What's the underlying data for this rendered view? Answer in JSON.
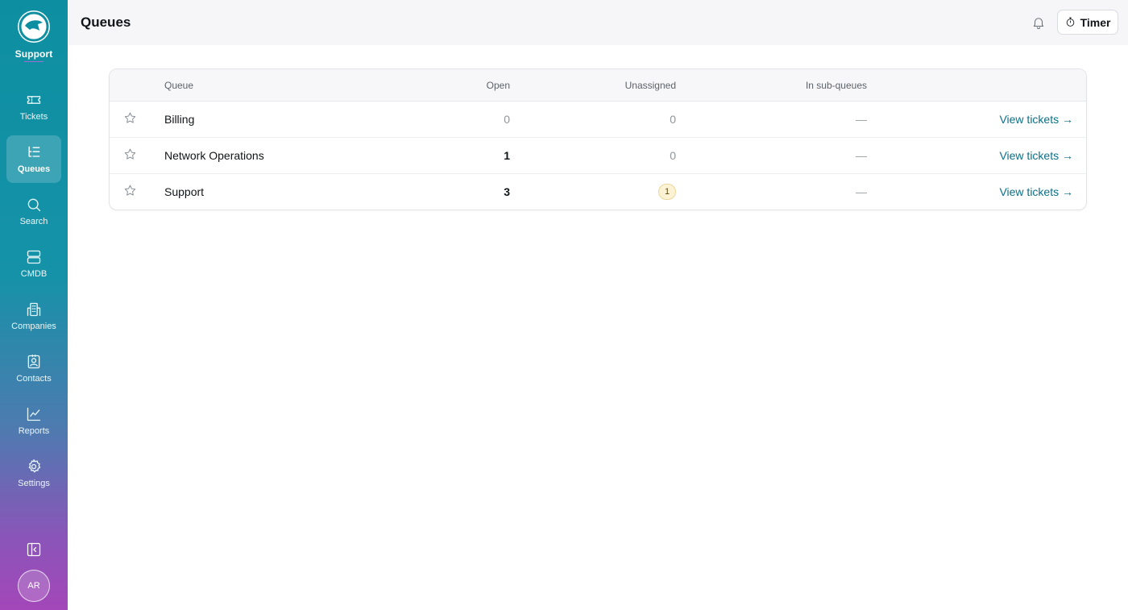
{
  "brand": {
    "name": "Support"
  },
  "nav": [
    {
      "id": "tickets",
      "label": "Tickets",
      "icon": "ticket-icon",
      "active": false
    },
    {
      "id": "queues",
      "label": "Queues",
      "icon": "queue-list-icon",
      "active": true
    },
    {
      "id": "search",
      "label": "Search",
      "icon": "search-icon",
      "active": false
    },
    {
      "id": "cmdb",
      "label": "CMDB",
      "icon": "server-icon",
      "active": false
    },
    {
      "id": "companies",
      "label": "Companies",
      "icon": "building-icon",
      "active": false
    },
    {
      "id": "contacts",
      "label": "Contacts",
      "icon": "contact-card-icon",
      "active": false
    },
    {
      "id": "reports",
      "label": "Reports",
      "icon": "line-chart-icon",
      "active": false
    },
    {
      "id": "settings",
      "label": "Settings",
      "icon": "gear-icon",
      "active": false
    }
  ],
  "user": {
    "initials": "AR"
  },
  "header": {
    "title": "Queues",
    "timer_label": "Timer"
  },
  "table": {
    "columns": {
      "queue": "Queue",
      "open": "Open",
      "unassigned": "Unassigned",
      "sub_queues": "In sub-queues"
    },
    "rows": [
      {
        "name": "Billing",
        "open": "0",
        "unassigned": "0",
        "sub_queues": "—",
        "link": "View tickets →"
      },
      {
        "name": "Network Operations",
        "open": "1",
        "unassigned": "0",
        "sub_queues": "—",
        "link": "View tickets →"
      },
      {
        "name": "Support",
        "open": "3",
        "unassigned": "1",
        "sub_queues": "—",
        "link": "View tickets →"
      }
    ]
  },
  "colors": {
    "accent": "#0e8fa1",
    "link": "#0e6f87",
    "badge_bg": "#fdf3d4"
  }
}
